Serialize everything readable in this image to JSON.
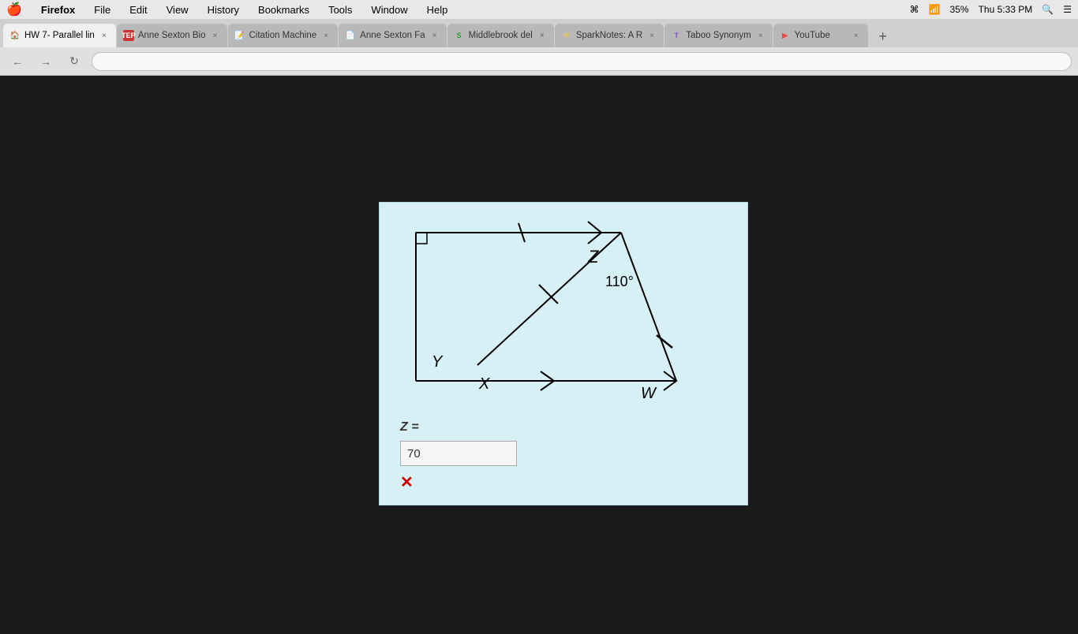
{
  "menubar": {
    "apple": "🍎",
    "items": [
      "Firefox",
      "File",
      "Edit",
      "View",
      "History",
      "Bookmarks",
      "Tools",
      "Window",
      "Help"
    ],
    "right": {
      "bluetooth": "bluetooth",
      "wifi": "wifi",
      "battery": "35%",
      "time": "Thu 5:33 PM",
      "search": "search",
      "menu": "menu"
    }
  },
  "tabs": [
    {
      "id": "tab1",
      "favicon": "🏠",
      "label": "HW 7- Parallel lin",
      "active": true,
      "color": "#e8864a"
    },
    {
      "id": "tab2",
      "favicon": "T",
      "label": "Anne Sexton Bio",
      "active": false,
      "color": "#e84a4a"
    },
    {
      "id": "tab3",
      "favicon": "📝",
      "label": "Citation Machine",
      "active": false,
      "color": "#aaa"
    },
    {
      "id": "tab4",
      "favicon": "📄",
      "label": "Anne Sexton Fa",
      "active": false,
      "color": "#4a8ee8"
    },
    {
      "id": "tab5",
      "favicon": "S",
      "label": "Middlebrook del",
      "active": false,
      "color": "#4ae84a"
    },
    {
      "id": "tab6",
      "favicon": "❋",
      "label": "SparkNotes: A R",
      "active": false,
      "color": "#e8e84a"
    },
    {
      "id": "tab7",
      "favicon": "T",
      "label": "Taboo Synonym",
      "active": false,
      "color": "#8e4ae8"
    },
    {
      "id": "tab8",
      "favicon": "▶",
      "label": "YouTube",
      "active": false,
      "color": "#e84a4a"
    }
  ],
  "diagram": {
    "angle_label": "110°",
    "vertex_z": "Z",
    "vertex_y": "Y",
    "vertex_x": "X",
    "vertex_w": "W"
  },
  "answer": {
    "z_label": "Z =",
    "input_value": "70",
    "wrong_mark": "✕"
  },
  "toolbar": {
    "back": "←",
    "forward": "→",
    "refresh": "↻",
    "url": ""
  }
}
